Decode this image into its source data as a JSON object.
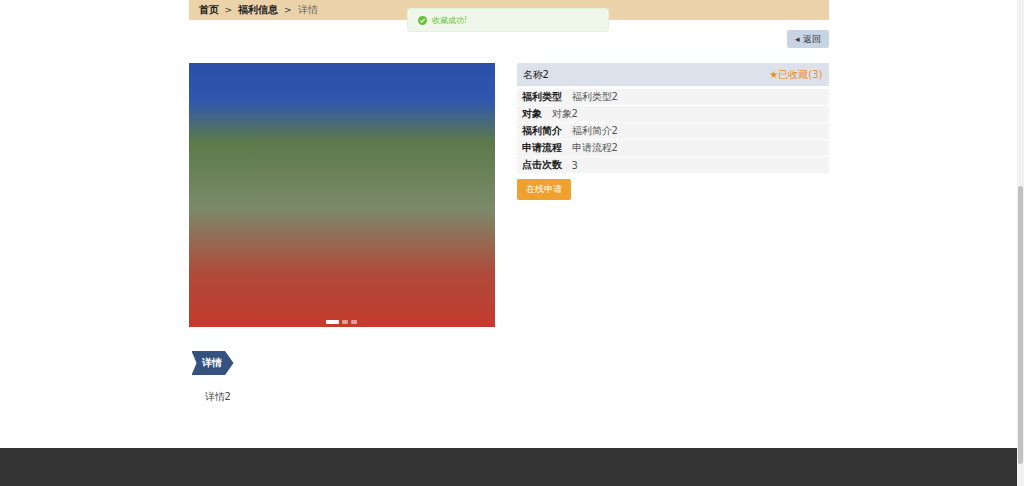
{
  "breadcrumb": {
    "items": [
      {
        "label": "首页",
        "current": false
      },
      {
        "label": "福利信息",
        "current": false
      },
      {
        "label": "详情",
        "current": true
      }
    ],
    "separator": ">"
  },
  "toast": {
    "message": "收藏成功!"
  },
  "back_button": {
    "icon": "◂",
    "label": "返回"
  },
  "carousel": {
    "dots": [
      {
        "selected": true
      },
      {
        "selected": false
      },
      {
        "selected": false
      }
    ]
  },
  "info": {
    "title": "名称2",
    "favorite": {
      "icon": "★",
      "label": "已收藏(3)",
      "selected": true
    },
    "rows": [
      {
        "label": "福利类型",
        "value": "福利类型2"
      },
      {
        "label": "对象",
        "value": "对象2"
      },
      {
        "label": "福利简介",
        "value": "福利简介2"
      },
      {
        "label": "申请流程",
        "value": "申请流程2"
      },
      {
        "label": "点击次数",
        "value": "3"
      }
    ],
    "apply_button": "在线申请"
  },
  "detail": {
    "tab": "详情",
    "content": "详情2"
  }
}
